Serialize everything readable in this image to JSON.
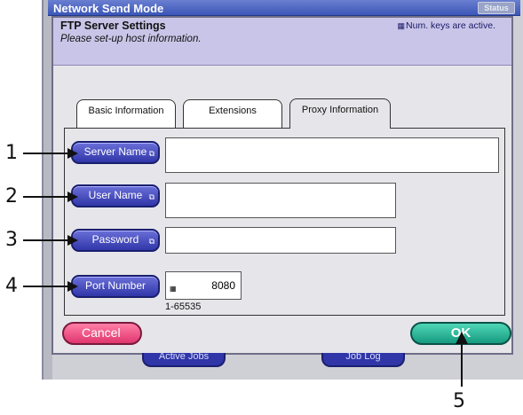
{
  "window": {
    "title": "Network Send Mode",
    "status_button": "Status"
  },
  "dialog": {
    "title": "FTP Server Settings",
    "subtitle": "Please set-up host information.",
    "num_keys_notice": "Num. keys are active."
  },
  "tabs": [
    {
      "label": "Basic Information"
    },
    {
      "label": "Extensions"
    },
    {
      "label": "Proxy Information"
    }
  ],
  "fields": {
    "server_name": {
      "label": "Server Name",
      "value": ""
    },
    "user_name": {
      "label": "User Name",
      "value": ""
    },
    "password": {
      "label": "Password",
      "value": ""
    },
    "port_number": {
      "label": "Port Number",
      "value": "8080",
      "range": "1-65535"
    }
  },
  "buttons": {
    "cancel": "Cancel",
    "ok": "OK"
  },
  "background_tabs": [
    {
      "label": "Active Jobs"
    },
    {
      "label": "Job Log"
    }
  ],
  "annotations": [
    "1",
    "2",
    "3",
    "4",
    "5"
  ]
}
